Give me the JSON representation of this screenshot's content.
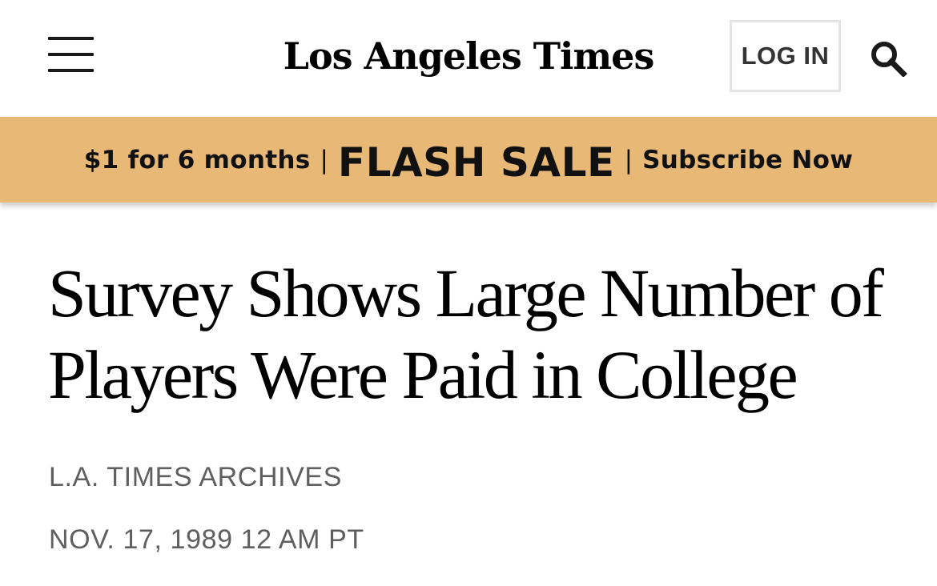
{
  "header": {
    "menu_icon": "hamburger-menu-icon",
    "logo_text": "Los Angeles Times",
    "login_label": "LOG IN",
    "search_icon": "search-icon"
  },
  "promo": {
    "offer": "$1 for 6 months",
    "separator_left": "|",
    "flash": "FLASH SALE",
    "separator_right": "|",
    "cta": "Subscribe Now",
    "background_color": "#e8b877"
  },
  "article": {
    "headline_line1": "Survey Shows Large Number of",
    "headline_line2": "Players Were Paid in College",
    "byline": "L.A. TIMES ARCHIVES",
    "dateline": "NOV. 17, 1989 12 AM PT"
  }
}
